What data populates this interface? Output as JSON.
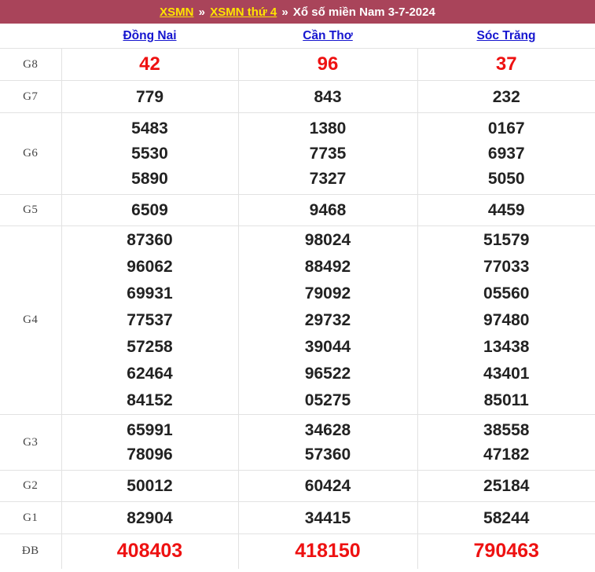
{
  "header": {
    "link1": "XSMN",
    "sep1": "»",
    "link2": "XSMN thứ 4",
    "sep2": "»",
    "tail": "Xổ số miền Nam 3-7-2024",
    "background_color": "#a9445a",
    "link_color": "#ffe400",
    "text_color": "#ffffff"
  },
  "columns": [
    {
      "name": "Đồng Nai"
    },
    {
      "name": "Cần Thơ"
    },
    {
      "name": "Sóc Trăng"
    }
  ],
  "colors": {
    "highlight_red": "#ee1111",
    "number_black": "#222222",
    "province_link": "#1515cf",
    "border": "#e2e2e2"
  },
  "rows": [
    {
      "label": "G8",
      "style": "red-large",
      "cells": [
        [
          "42"
        ],
        [
          "96"
        ],
        [
          "37"
        ]
      ]
    },
    {
      "label": "G7",
      "style": "normal",
      "cells": [
        [
          "779"
        ],
        [
          "843"
        ],
        [
          "232"
        ]
      ]
    },
    {
      "label": "G6",
      "style": "normal",
      "cells": [
        [
          "5483",
          "5530",
          "5890"
        ],
        [
          "1380",
          "7735",
          "7327"
        ],
        [
          "0167",
          "6937",
          "5050"
        ]
      ]
    },
    {
      "label": "G5",
      "style": "normal",
      "cells": [
        [
          "6509"
        ],
        [
          "9468"
        ],
        [
          "4459"
        ]
      ]
    },
    {
      "label": "G4",
      "style": "normal",
      "cells": [
        [
          "87360",
          "96062",
          "69931",
          "77537",
          "57258",
          "62464",
          "84152"
        ],
        [
          "98024",
          "88492",
          "79092",
          "29732",
          "39044",
          "96522",
          "05275"
        ],
        [
          "51579",
          "77033",
          "05560",
          "97480",
          "13438",
          "43401",
          "85011"
        ]
      ]
    },
    {
      "label": "G3",
      "style": "normal",
      "cells": [
        [
          "65991",
          "78096"
        ],
        [
          "34628",
          "57360"
        ],
        [
          "38558",
          "47182"
        ]
      ]
    },
    {
      "label": "G2",
      "style": "normal",
      "cells": [
        [
          "50012"
        ],
        [
          "60424"
        ],
        [
          "25184"
        ]
      ]
    },
    {
      "label": "G1",
      "style": "normal",
      "cells": [
        [
          "82904"
        ],
        [
          "34415"
        ],
        [
          "58244"
        ]
      ]
    },
    {
      "label": "ĐB",
      "style": "red-xlarge",
      "cells": [
        [
          "408403"
        ],
        [
          "418150"
        ],
        [
          "790463"
        ]
      ]
    }
  ]
}
